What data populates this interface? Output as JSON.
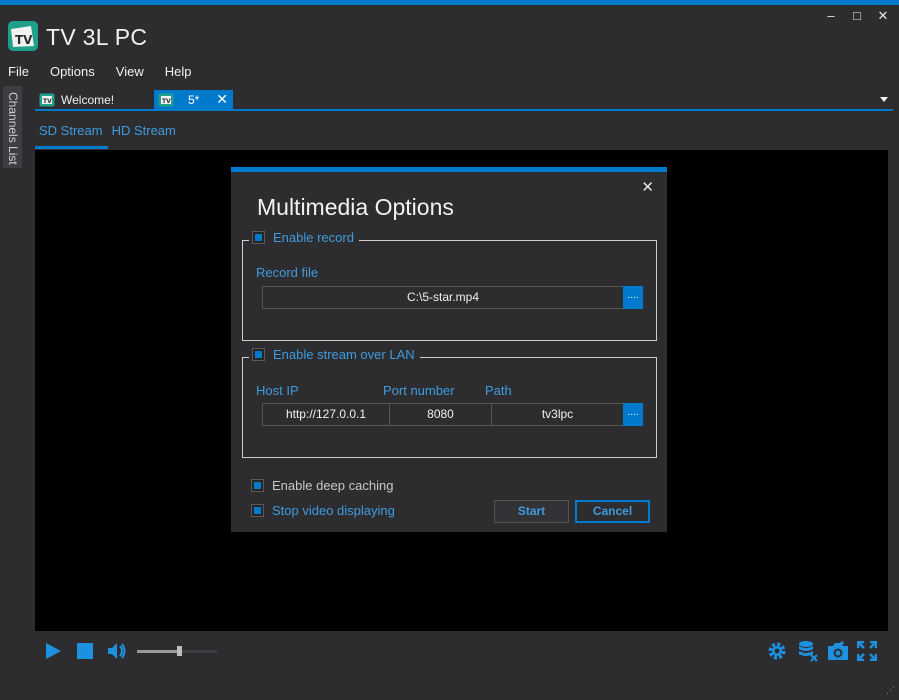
{
  "app": {
    "title": "TV 3L PC",
    "window_controls": {
      "minimize": "–",
      "maximize": "□",
      "close": "✕"
    }
  },
  "menu": [
    "File",
    "Options",
    "View",
    "Help"
  ],
  "sidebar": {
    "channels_label": "Channels List"
  },
  "doc_tabs": [
    {
      "label": "Welcome!",
      "active": false
    },
    {
      "label": "5*",
      "active": true
    }
  ],
  "stream_tabs": [
    {
      "label": "SD Stream",
      "active": true
    },
    {
      "label": "HD Stream",
      "active": false
    }
  ],
  "player": {
    "volume_fraction": 0.52,
    "icons": [
      "play-icon",
      "stop-icon",
      "volume-icon",
      "settings-icon",
      "database-icon",
      "camera-icon",
      "fullscreen-icon"
    ]
  },
  "dialog": {
    "title": "Multimedia Options",
    "close": "✕",
    "record": {
      "enabled_label": "Enable record",
      "checked": true,
      "file_label": "Record file",
      "file_value": "C:\\5-star.mp4",
      "browse_label": "...."
    },
    "stream": {
      "enabled_label": "Enable stream over LAN",
      "checked": true,
      "host_label": "Host IP",
      "port_label": "Port number",
      "path_label": "Path",
      "host_value": "http://127.0.0.1",
      "port_value": "8080",
      "path_value": "tv3lpc",
      "browse_label": "...."
    },
    "deep_caching": {
      "label": "Enable deep caching",
      "checked": true
    },
    "stop_video": {
      "label": "Stop video displaying",
      "checked": true
    },
    "start_label": "Start",
    "cancel_label": "Cancel"
  },
  "colors": {
    "accent": "#007acc",
    "link": "#3f9bdd",
    "background": "#2d2d30"
  }
}
